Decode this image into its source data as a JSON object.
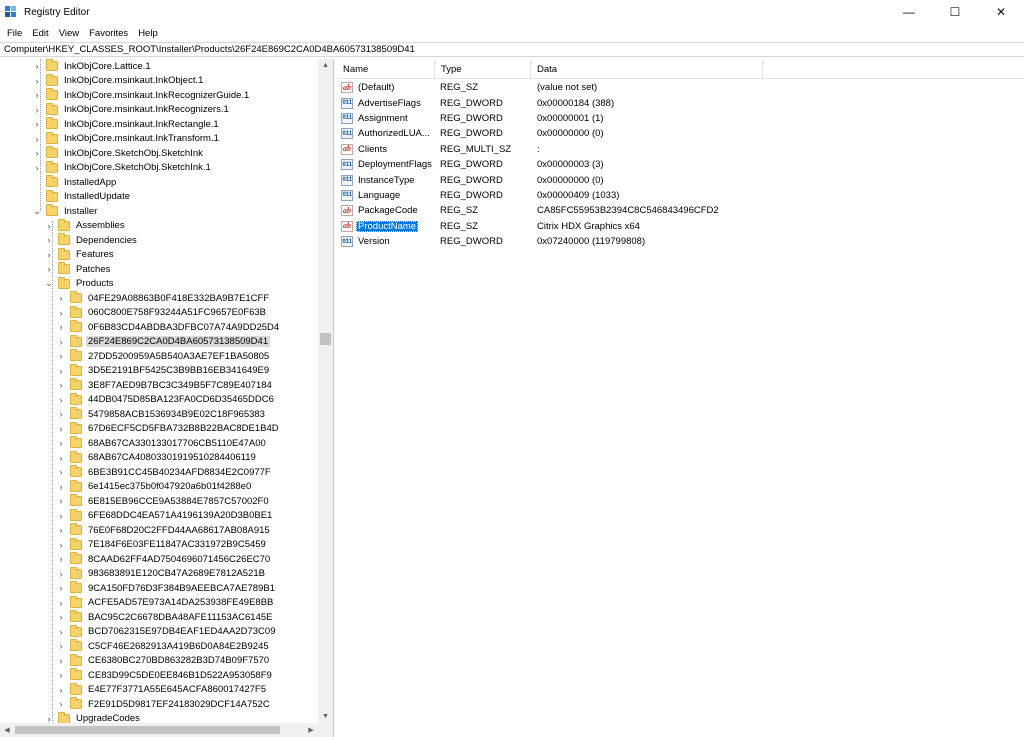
{
  "window": {
    "title": "Registry Editor",
    "controls": [
      "—",
      "☐",
      "✕"
    ]
  },
  "menu": [
    "File",
    "Edit",
    "View",
    "Favorites",
    "Help"
  ],
  "address": "Computer\\HKEY_CLASSES_ROOT\\Installer\\Products\\26F24E869C2CA0D4BA60573138509D41",
  "tree": {
    "items": [
      {
        "label": "InkObjCore.Lattice.1",
        "level": 0,
        "expander": "›"
      },
      {
        "label": "InkObjCore.msinkaut.InkObject.1",
        "level": 0,
        "expander": "›"
      },
      {
        "label": "InkObjCore.msinkaut.InkRecognizerGuide.1",
        "level": 0,
        "expander": "›"
      },
      {
        "label": "InkObjCore.msinkaut.InkRecognizers.1",
        "level": 0,
        "expander": "›"
      },
      {
        "label": "InkObjCore.msinkaut.InkRectangle.1",
        "level": 0,
        "expander": "›"
      },
      {
        "label": "InkObjCore.msinkaut.InkTransform.1",
        "level": 0,
        "expander": "›"
      },
      {
        "label": "InkObjCore.SketchObj.SketchInk",
        "level": 0,
        "expander": "›"
      },
      {
        "label": "InkObjCore.SketchObj.SketchInk.1",
        "level": 0,
        "expander": "›"
      },
      {
        "label": "InstalledApp",
        "level": 0,
        "expander": ""
      },
      {
        "label": "InstalledUpdate",
        "level": 0,
        "expander": ""
      },
      {
        "label": "Installer",
        "level": 0,
        "expander": "⌄"
      },
      {
        "label": "Assemblies",
        "level": 1,
        "expander": "›"
      },
      {
        "label": "Dependencies",
        "level": 1,
        "expander": "›"
      },
      {
        "label": "Features",
        "level": 1,
        "expander": "›"
      },
      {
        "label": "Patches",
        "level": 1,
        "expander": "›"
      },
      {
        "label": "Products",
        "level": 1,
        "expander": "⌄"
      },
      {
        "label": "04FE29A08863B0F418E332BA9B7E1CFF",
        "level": 2,
        "expander": "›"
      },
      {
        "label": "060C800E758F93244A51FC9657E0F63B",
        "level": 2,
        "expander": "›"
      },
      {
        "label": "0F6B83CD4ABDBA3DFBC07A74A9DD25D4",
        "level": 2,
        "expander": "›"
      },
      {
        "label": "26F24E869C2CA0D4BA60573138509D41",
        "level": 2,
        "expander": "›",
        "selected": true
      },
      {
        "label": "27DD5200959A5B540A3AE7EF1BA50805",
        "level": 2,
        "expander": "›"
      },
      {
        "label": "3D5E2191BF5425C3B9BB16EB341649E9",
        "level": 2,
        "expander": "›"
      },
      {
        "label": "3E8F7AED9B7BC3C349B5F7C89E407184",
        "level": 2,
        "expander": "›"
      },
      {
        "label": "44DB0475D85BA123FA0CD6D35465DDC6",
        "level": 2,
        "expander": "›"
      },
      {
        "label": "5479858ACB1536934B9E02C18F965383",
        "level": 2,
        "expander": "›"
      },
      {
        "label": "67D6ECF5CD5FBA732B8B22BAC8DE1B4D",
        "level": 2,
        "expander": "›"
      },
      {
        "label": "68AB67CA330133017706CB5110E47A00",
        "level": 2,
        "expander": "›"
      },
      {
        "label": "68AB67CA40803301919510284406119",
        "level": 2,
        "expander": "›"
      },
      {
        "label": "6BE3B91CC45B40234AFD8834E2C0977F",
        "level": 2,
        "expander": "›"
      },
      {
        "label": "6e1415ec375b0f047920a6b01f4288e0",
        "level": 2,
        "expander": "›"
      },
      {
        "label": "6E815EB96CCE9A53884E7857C57002F0",
        "level": 2,
        "expander": "›"
      },
      {
        "label": "6FE68DDC4EA571A4196139A20D3B0BE1",
        "level": 2,
        "expander": "›"
      },
      {
        "label": "76E0F68D20C2FFD44AA68617AB08A915",
        "level": 2,
        "expander": "›"
      },
      {
        "label": "7E184F6E03FE11847AC331972B9C5459",
        "level": 2,
        "expander": "›"
      },
      {
        "label": "8CAAD62FF4AD7504696071456C26EC70",
        "level": 2,
        "expander": "›"
      },
      {
        "label": "983683891E120CB47A2689E7812A521B",
        "level": 2,
        "expander": "›"
      },
      {
        "label": "9CA150FD76D3F384B9AEEBCA7AE789B1",
        "level": 2,
        "expander": "›"
      },
      {
        "label": "ACFE5AD57E973A14DA253938FE49E8BB",
        "level": 2,
        "expander": "›"
      },
      {
        "label": "BAC95C2C6678DBA48AFE11153AC6145E",
        "level": 2,
        "expander": "›"
      },
      {
        "label": "BCD7062315E97DB4EAF1ED4AA2D73C09",
        "level": 2,
        "expander": "›"
      },
      {
        "label": "C5CF46E2682913A419B6D0A84E2B9245",
        "level": 2,
        "expander": "›"
      },
      {
        "label": "CE6380BC270BD863282B3D74B09F7570",
        "level": 2,
        "expander": "›"
      },
      {
        "label": "CE83D99C5DE0EE846B1D522A953058F9",
        "level": 2,
        "expander": "›"
      },
      {
        "label": "E4E77F3771A55E645ACFA860017427F5",
        "level": 2,
        "expander": "›"
      },
      {
        "label": "F2E91D5D9817EF24183029DCF14A752C",
        "level": 2,
        "expander": "›"
      },
      {
        "label": "UpgradeCodes",
        "level": 1,
        "expander": "›"
      }
    ]
  },
  "values": {
    "columns": [
      "Name",
      "Type",
      "Data"
    ],
    "rows": [
      {
        "icon": "string-value-icon",
        "name": "(Default)",
        "type": "REG_SZ",
        "data": "(value not set)"
      },
      {
        "icon": "binary-value-icon",
        "name": "AdvertiseFlags",
        "type": "REG_DWORD",
        "data": "0x00000184 (388)"
      },
      {
        "icon": "binary-value-icon",
        "name": "Assignment",
        "type": "REG_DWORD",
        "data": "0x00000001 (1)"
      },
      {
        "icon": "binary-value-icon",
        "name": "AuthorizedLUA...",
        "type": "REG_DWORD",
        "data": "0x00000000 (0)"
      },
      {
        "icon": "string-value-icon",
        "name": "Clients",
        "type": "REG_MULTI_SZ",
        "data": ":"
      },
      {
        "icon": "binary-value-icon",
        "name": "DeploymentFlags",
        "type": "REG_DWORD",
        "data": "0x00000003 (3)"
      },
      {
        "icon": "binary-value-icon",
        "name": "InstanceType",
        "type": "REG_DWORD",
        "data": "0x00000000 (0)"
      },
      {
        "icon": "binary-value-icon",
        "name": "Language",
        "type": "REG_DWORD",
        "data": "0x00000409 (1033)"
      },
      {
        "icon": "string-value-icon",
        "name": "PackageCode",
        "type": "REG_SZ",
        "data": "CA85FC55953B2394C8C546843496CFD2"
      },
      {
        "icon": "string-value-icon",
        "name": "ProductName",
        "type": "REG_SZ",
        "data": "Citrix HDX Graphics x64",
        "selected": true
      },
      {
        "icon": "binary-value-icon",
        "name": "Version",
        "type": "REG_DWORD",
        "data": "0x07240000 (119799808)"
      }
    ]
  },
  "colors": {
    "selection": "#0078d7",
    "tree_selection": "#d9d9d9",
    "folder": "#f6d26b"
  }
}
